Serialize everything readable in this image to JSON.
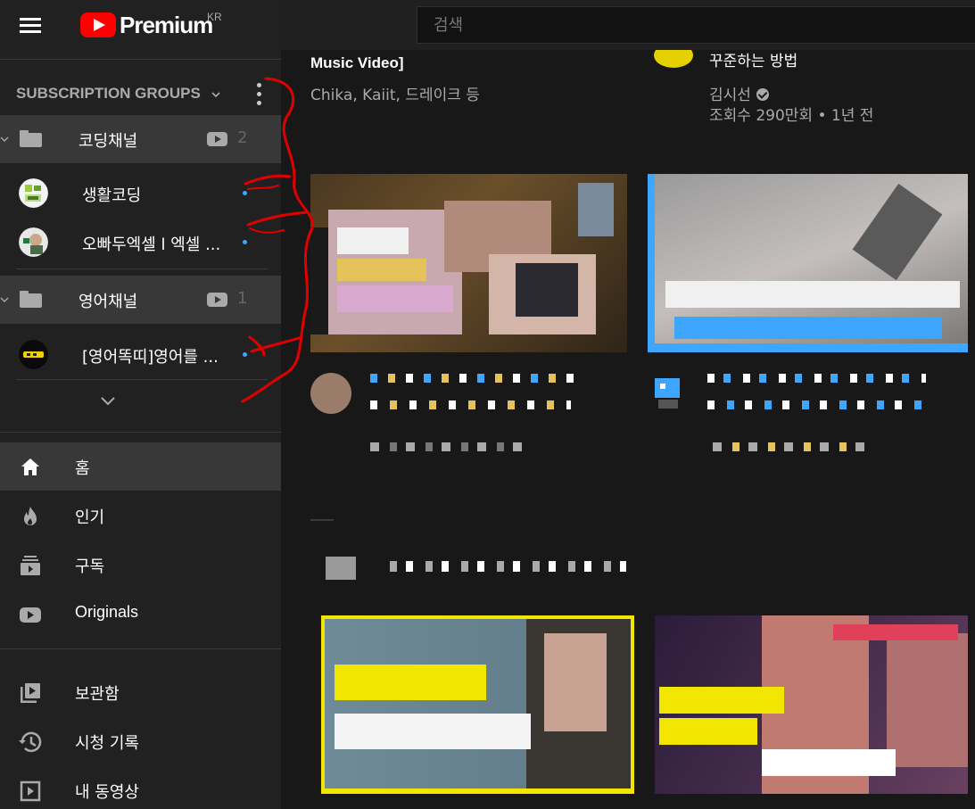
{
  "header": {
    "logo_text": "Premium",
    "region": "KR",
    "search_placeholder": "검색"
  },
  "sidebar": {
    "subscription_groups_title": "SUBSCRIPTION GROUPS",
    "groups": [
      {
        "name": "코딩채널",
        "count": "2",
        "channels": [
          {
            "name": "생활코딩"
          },
          {
            "name": "오빠두엑셀 l 엑셀 ..."
          }
        ]
      },
      {
        "name": "영어채널",
        "count": "1",
        "channels": [
          {
            "name": "[영어똑띠]영어를 ..."
          }
        ]
      }
    ],
    "nav": [
      {
        "label": "홈",
        "icon": "home-icon"
      },
      {
        "label": "인기",
        "icon": "trending-icon"
      },
      {
        "label": "구독",
        "icon": "subscriptions-icon"
      },
      {
        "label": "Originals",
        "icon": "originals-icon"
      },
      {
        "label": "보관함",
        "icon": "library-icon"
      },
      {
        "label": "시청 기록",
        "icon": "history-icon"
      },
      {
        "label": "내 동영상",
        "icon": "your-videos-icon"
      }
    ]
  },
  "main": {
    "partial_video_1": {
      "title": "Music Video]",
      "channels": "Chika, Kaiit, 드레이크 등"
    },
    "partial_video_2": {
      "title": "꾸준하는 방법",
      "channel": "김시선",
      "meta": "조회수 290만회 • 1년 전"
    }
  },
  "colors": {
    "brand_red": "#ff0000",
    "accent_blue": "#3ea6ff",
    "annotation_red": "#e00000"
  }
}
